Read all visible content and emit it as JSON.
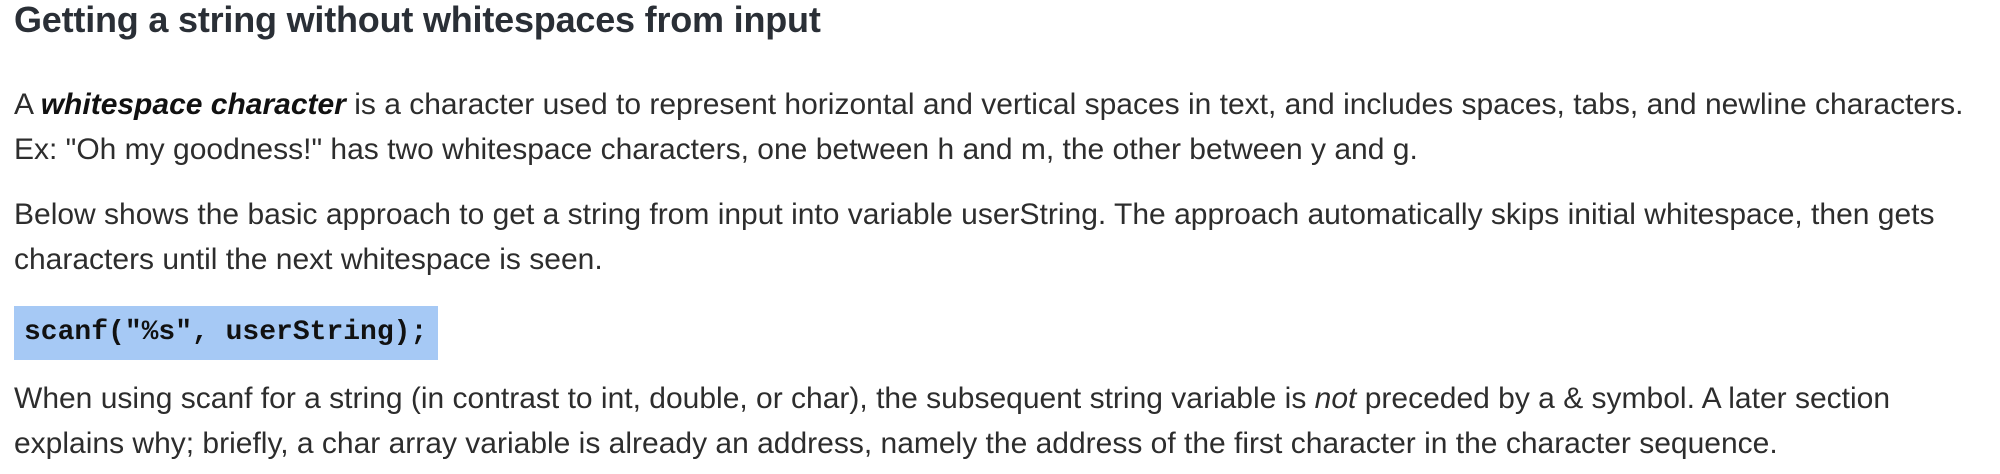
{
  "heading": "Getting a string without whitespaces from input",
  "p1": {
    "before": "A ",
    "term": "whitespace character",
    "after": " is a character used to represent horizontal and vertical spaces in text, and includes spaces, tabs, and newline characters. Ex: \"Oh my goodness!\" has two whitespace characters, one between h and m, the other between y and g."
  },
  "p2": "Below shows the basic approach to get a string from input into variable userString. The approach automatically skips initial whitespace, then gets characters until the next whitespace is seen.",
  "code": "scanf(\"%s\", userString);",
  "p3": {
    "before": "When using scanf for a string (in contrast to int, double, or char), the subsequent string variable is ",
    "emphasis": "not",
    "after": " preceded by a & symbol. A later section explains why; briefly, a char array variable is already an address, namely the address of the first character in the character sequence."
  },
  "colors": {
    "code_highlight": "#a6c9f5",
    "heading": "#2a2f36",
    "body_text": "#2d2d2d"
  }
}
